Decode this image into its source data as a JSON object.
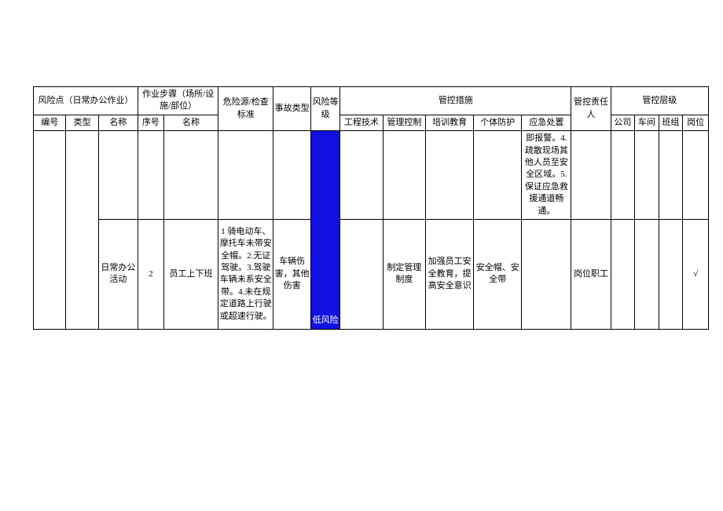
{
  "header": {
    "risk_point": "风险点（日常办公作业）",
    "op_steps": "作业步骤（场所/设施/部位）",
    "hazard_std": "危险源/检查标准",
    "accident_type": "事故类型",
    "risk_level": "风险等级",
    "control_measures": "管控措施",
    "responsible": "管控责任人",
    "control_level": "管控层级",
    "sub": {
      "bianhao": "编号",
      "leixing": "类型",
      "mingcheng": "名称",
      "xuhao": "序号",
      "gongcheng": "工程技术",
      "guanli": "管理控制",
      "peixun": "培训教育",
      "geti": "个体防护",
      "yingji": "应急处置",
      "gongsi": "公司",
      "chejian": "车间",
      "banzu": "班组",
      "gangwei": "岗位"
    }
  },
  "rows": [
    {
      "bianhao": "",
      "leixing": "",
      "mingcheng1": "",
      "xuhao": "",
      "mingcheng2": "",
      "weixian": "",
      "shigu": "",
      "fengxian": "",
      "gongcheng": "",
      "guanli": "",
      "peixun": "",
      "geti": "",
      "yingji": "即报警。4.疏散现场其他人员至安全区域。5.保证应急救援通道畅通。",
      "zeren": "",
      "gongsi": "",
      "chejian": "",
      "banzu": "",
      "gangwei": ""
    },
    {
      "bianhao": "",
      "leixing": "",
      "mingcheng1": "日常办公活动",
      "xuhao": "2",
      "mingcheng2": "员工上下班",
      "weixian": "1 骑电动车、摩托车未带安全帽。2.无证驾驶。3.驾驶车辆未系安全带。4.未在规定道路上行驶或超速行驶。",
      "shigu": "车辆伤害，其他伤害",
      "fengxian": "低风险",
      "gongcheng": "",
      "guanli": "制定管理制度",
      "peixun": "加强员工安全教育，提高安全意识",
      "geti": "安全帽、安全带",
      "yingji": "",
      "zeren": "岗位职工",
      "gongsi": "",
      "chejian": "",
      "banzu": "",
      "gangwei": "√"
    }
  ]
}
